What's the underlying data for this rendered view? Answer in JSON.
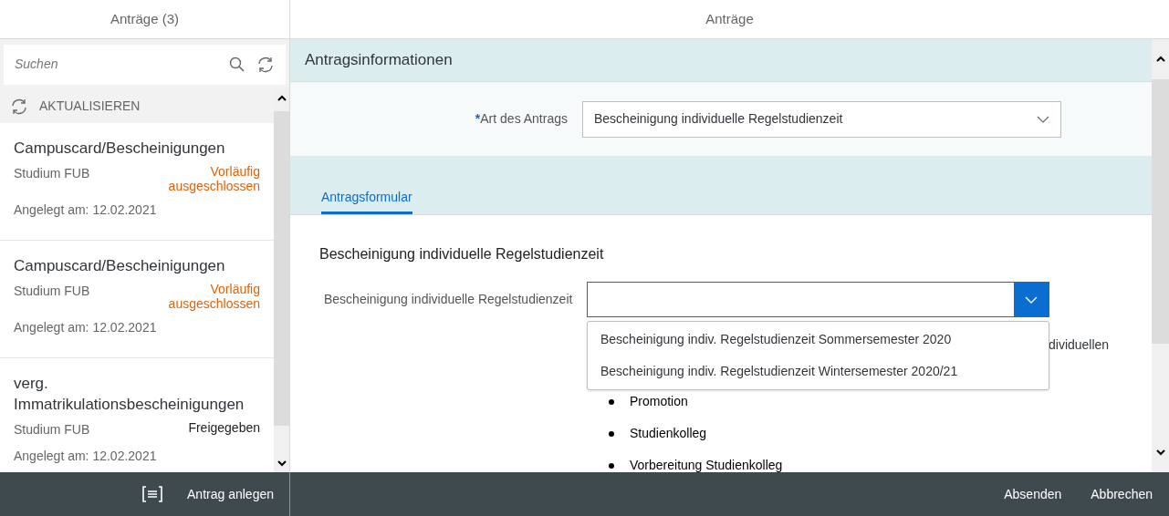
{
  "master": {
    "title": "Anträge (3)",
    "search": {
      "placeholder": "Suchen"
    },
    "refresh_label": "AKTUALISIEREN",
    "items": [
      {
        "title": "Campuscard/Bescheinigungen",
        "subtitle": "Studium FUB",
        "status": "Vorläufig ausgeschlossen",
        "color": "#d9640b",
        "created": "Angelegt am: 12.02.2021"
      },
      {
        "title": "Campuscard/Bescheinigungen",
        "subtitle": "Studium FUB",
        "status": "Vorläufig ausgeschlossen",
        "color": "#d9640b",
        "created": "Angelegt am: 12.02.2021"
      },
      {
        "title": "verg. Immatrikulationsbescheinigungen",
        "subtitle": "Studium FUB",
        "status": "Freigegeben",
        "color": "#222222",
        "created": "Angelegt am: 12.02.2021"
      }
    ],
    "footer_button": "Antrag anlegen"
  },
  "detail": {
    "title": "Anträge",
    "section_title": "Antragsinformationen",
    "type_field": {
      "required_mark": "*",
      "label": "Art des Antrags",
      "value": "Bescheinigung individuelle Regelstudienzeit"
    },
    "tabs": [
      {
        "label": "Antragsformular",
        "selected": true
      }
    ],
    "form_title": "Bescheinigung individuelle Regelstudienzeit",
    "select_field": {
      "label": "Bescheinigung individuelle Regelstudienzeit",
      "expanded": true,
      "options": [
        "Bescheinigung indiv. Regelstudienzeit Sommersemester 2020",
        "Bescheinigung indiv. Regelstudienzeit Wintersemester 2020/21"
      ]
    },
    "paragraph_fragment": "dividuellen",
    "bullets": [
      "Promotion",
      "Studienkolleg",
      "Vorbereitung Studienkolleg"
    ],
    "footer_buttons": [
      "Absenden",
      "Abbrechen"
    ]
  }
}
